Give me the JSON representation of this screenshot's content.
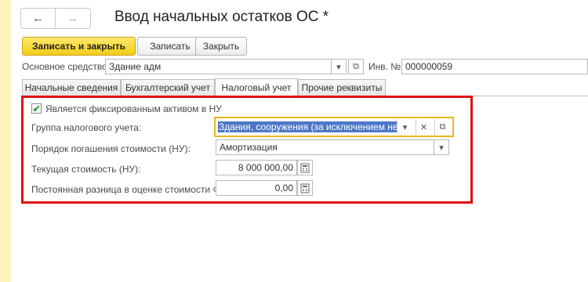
{
  "window": {
    "title": "Ввод начальных остатков ОС *",
    "nav": {
      "back_icon": "←",
      "forward_icon": "→"
    }
  },
  "toolbar": {
    "save_close_label": "Записать и закрыть",
    "save_label": "Записать",
    "close_label": "Закрыть"
  },
  "header": {
    "asset_label": "Основное средство:",
    "asset_value": "Здание адм",
    "inv_label": "Инв. №:",
    "inv_value": "000000059"
  },
  "tabs": [
    {
      "label": "Начальные сведения",
      "active": false
    },
    {
      "label": "Бухгалтерский учет",
      "active": false
    },
    {
      "label": "Налоговый учет",
      "active": true
    },
    {
      "label": "Прочие реквизиты",
      "active": false
    }
  ],
  "tax": {
    "fixed_asset_label": "Является фиксированным активом в НУ",
    "fixed_asset_checked": true,
    "group_label": "Группа налогового учета:",
    "group_value": "Здания, сооружения (за исключением нефтя",
    "method_label": "Порядок погашения стоимости (НУ):",
    "method_value": "Амортизация",
    "current_cost_label": "Текущая стоимость (НУ):",
    "current_cost_value": "8 000 000,00",
    "diff_label": "Постоянная разница в оценке стоимости ФА:",
    "diff_value": "0,00"
  },
  "colors": {
    "primary_button": "#f4cc18",
    "highlight_border": "#e01010",
    "focus_border": "#e8b820",
    "selection": "#4d78c8",
    "page_background": "#fbf5bd"
  }
}
